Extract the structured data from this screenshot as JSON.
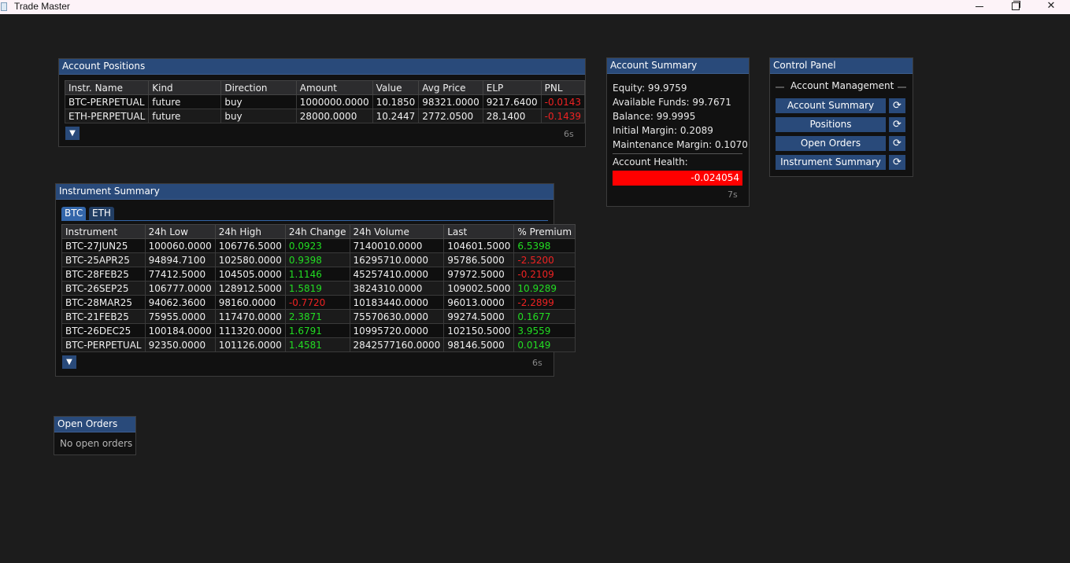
{
  "window": {
    "title": "Trade Master",
    "minimize": "—",
    "maximize": "□",
    "close": "✕"
  },
  "account_positions": {
    "title": "Account Positions",
    "columns": [
      "Instr. Name",
      "Kind",
      "Direction",
      "Amount",
      "Value",
      "Avg Price",
      "ELP",
      "PNL"
    ],
    "rows": [
      [
        "BTC-PERPETUAL",
        "future",
        "buy",
        "1000000.0000",
        "10.1850",
        "98321.0000",
        "9217.6400",
        "-0.0143"
      ],
      [
        "ETH-PERPETUAL",
        "future",
        "buy",
        "28000.0000",
        "10.2447",
        "2772.0500",
        "28.1400",
        "-0.1439"
      ]
    ],
    "expand_icon": "triangle-down-icon",
    "age": "6s"
  },
  "account_summary": {
    "title": "Account Summary",
    "equity": "Equity: 99.9759",
    "available_funds": "Available Funds: 99.7671",
    "balance": "Balance: 99.9995",
    "initial_margin": "Initial Margin: 0.2089",
    "maintenance_margin": "Maintenance Margin: 0.1070",
    "health_label": "Account Health:",
    "health_value": "-0.024054",
    "health_color": "#ff0000",
    "age": "7s"
  },
  "control_panel": {
    "title": "Control Panel",
    "section": "Account Management",
    "buttons": [
      "Account Summary",
      "Positions",
      "Open Orders",
      "Instrument Summary"
    ],
    "refresh_icon": "refresh-icon"
  },
  "instrument_summary": {
    "title": "Instrument Summary",
    "tabs": [
      "BTC",
      "ETH"
    ],
    "active_tab": "BTC",
    "columns": [
      "Instrument",
      "24h Low",
      "24h High",
      "24h Change",
      "24h Volume",
      "Last",
      "% Premium"
    ],
    "rows": [
      [
        "BTC-27JUN25",
        "100060.0000",
        "106776.5000",
        "0.0923",
        "7140010.0000",
        "104601.5000",
        "6.5398"
      ],
      [
        "BTC-25APR25",
        "94894.7100",
        "102580.0000",
        "0.9398",
        "16295710.0000",
        "95786.5000",
        "-2.5200"
      ],
      [
        "BTC-28FEB25",
        "77412.5000",
        "104505.0000",
        "1.1146",
        "45257410.0000",
        "97972.5000",
        "-0.2109"
      ],
      [
        "BTC-26SEP25",
        "106777.0000",
        "128912.5000",
        "1.5819",
        "3824310.0000",
        "109002.5000",
        "10.9289"
      ],
      [
        "BTC-28MAR25",
        "94062.3600",
        "98160.0000",
        "-0.7720",
        "10183440.0000",
        "96013.0000",
        "-2.2899"
      ],
      [
        "BTC-21FEB25",
        "75955.0000",
        "117470.0000",
        "2.3871",
        "75570630.0000",
        "99274.5000",
        "0.1677"
      ],
      [
        "BTC-26DEC25",
        "100184.0000",
        "111320.0000",
        "1.6791",
        "10995720.0000",
        "102150.5000",
        "3.9559"
      ],
      [
        "BTC-PERPETUAL",
        "92350.0000",
        "101126.0000",
        "1.4581",
        "2842577160.0000",
        "98146.5000",
        "0.0149"
      ]
    ],
    "expand_icon": "triangle-down-icon",
    "age": "6s"
  },
  "open_orders": {
    "title": "Open Orders",
    "empty_text": "No open orders"
  },
  "colors": {
    "accent": "#294a7a",
    "positive": "#22dd22",
    "negative": "#ee2222",
    "background": "#1c1c1c"
  }
}
